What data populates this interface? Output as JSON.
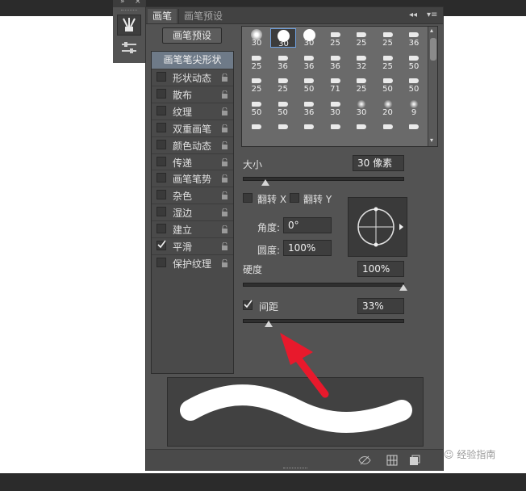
{
  "panel": {
    "tabs": [
      {
        "label": "画笔"
      },
      {
        "label": "画笔预设"
      }
    ],
    "preset_button": "画笔预设",
    "sidebar_header": "画笔笔尖形状",
    "sidebar_items": [
      {
        "label": "形状动态",
        "checked": false
      },
      {
        "label": "散布",
        "checked": false
      },
      {
        "label": "纹理",
        "checked": false
      },
      {
        "label": "双重画笔",
        "checked": false
      },
      {
        "label": "颜色动态",
        "checked": false
      },
      {
        "label": "传递",
        "checked": false
      },
      {
        "label": "画笔笔势",
        "checked": false
      },
      {
        "label": "杂色",
        "checked": false
      },
      {
        "label": "湿边",
        "checked": false
      },
      {
        "label": "建立",
        "checked": false
      },
      {
        "label": "平滑",
        "checked": true
      },
      {
        "label": "保护纹理",
        "checked": false
      }
    ],
    "brush_sizes": [
      [
        "30",
        "30",
        "30",
        "25",
        "25",
        "25",
        "36"
      ],
      [
        "25",
        "36",
        "36",
        "36",
        "32",
        "25",
        "50"
      ],
      [
        "25",
        "25",
        "50",
        "71",
        "25",
        "50",
        "50"
      ],
      [
        "50",
        "50",
        "36",
        "30",
        "30",
        "20",
        "9"
      ],
      [
        "",
        "",
        "",
        "",
        "",
        "",
        ""
      ]
    ],
    "size_label": "大小",
    "size_value": "30 像素",
    "flip_x_label": "翻转 X",
    "flip_y_label": "翻转 Y",
    "angle_label": "角度:",
    "angle_value": "0°",
    "roundness_label": "圆度:",
    "roundness_value": "100%",
    "hardness_label": "硬度",
    "hardness_value": "100%",
    "spacing_label": "间距",
    "spacing_value": "33%",
    "spacing_checked": true
  },
  "watermark": "经验指南",
  "colors": {
    "panel_bg": "#535353",
    "selected_header": "#6e7a88",
    "arrow": "#e8192c"
  }
}
